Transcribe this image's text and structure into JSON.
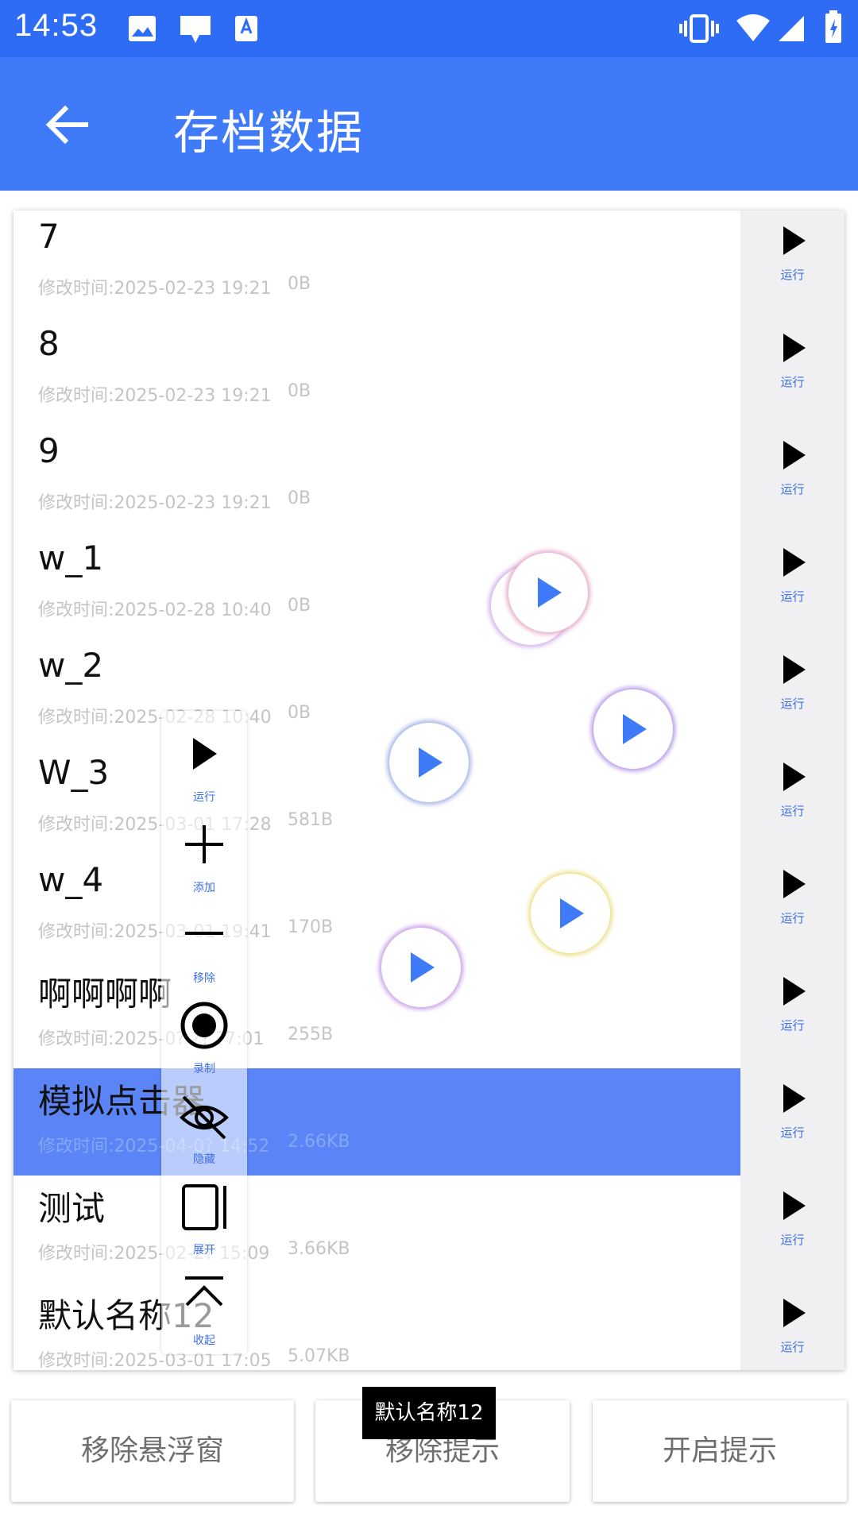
{
  "status_bar": {
    "time": "14:53"
  },
  "app_bar": {
    "title": "存档数据"
  },
  "rows": [
    {
      "name": "7",
      "time": "修改时间:2025-02-23 19:21",
      "size": "0B"
    },
    {
      "name": "8",
      "time": "修改时间:2025-02-23 19:21",
      "size": "0B"
    },
    {
      "name": "9",
      "time": "修改时间:2025-02-23 19:21",
      "size": "0B"
    },
    {
      "name": "w_1",
      "time": "修改时间:2025-02-28 10:40",
      "size": "0B"
    },
    {
      "name": "w_2",
      "time": "修改时间:2025-02-28 10:40",
      "size": "0B"
    },
    {
      "name": "W_3",
      "time": "修改时间:2025-03-01 17:28",
      "size": "581B"
    },
    {
      "name": "w_4",
      "time": "修改时间:2025-03-01 19:41",
      "size": "170B"
    },
    {
      "name": "啊啊啊啊",
      "time": "修改时间:2025-0?-?? ?7:01",
      "size": "255B"
    },
    {
      "name": "模拟点击器",
      "time": "修改时间:2025-04-0? 14:52",
      "size": "2.66KB"
    },
    {
      "name": "测试",
      "time": "修改时间:2025-02-2? 15:09",
      "size": "3.66KB"
    },
    {
      "name": "默认名称12",
      "time": "修改时间:2025-03-01 17:05",
      "size": "5.07KB"
    }
  ],
  "run_label": "运行",
  "selected_row_index": 8,
  "float_toolbar": {
    "run": "运行",
    "add": "添加",
    "remove": "移除",
    "record": "录制",
    "hide": "隐藏",
    "expand": "展开",
    "collapse": "收起"
  },
  "bubble_ring_colors": [
    "#c9a0e8",
    "#e7aecb",
    "#b69be8",
    "#a6b4e8",
    "#ece08a",
    "#c9a0e8"
  ],
  "accent_color": "#3f7af8",
  "bottom_buttons": {
    "remove_float": "移除悬浮窗",
    "remove_tip": "移除提示",
    "enable_tip": "开启提示"
  },
  "toast": "默认名称12"
}
